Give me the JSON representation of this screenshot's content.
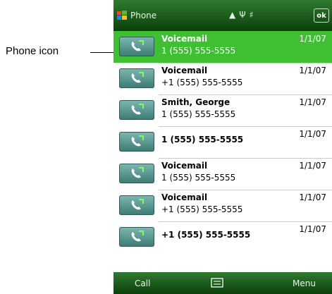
{
  "callout": {
    "label": "Phone icon"
  },
  "titlebar": {
    "title": "Phone",
    "status_icons": [
      "signal-icon",
      "antenna-icon",
      "volume-icon"
    ],
    "ok_label": "ok"
  },
  "call_log": [
    {
      "name": "Voicemail",
      "number": "1 (555) 555-5555",
      "date": "1/1/07",
      "selected": true
    },
    {
      "name": "Voicemail",
      "number": "+1 (555) 555-5555",
      "date": "1/1/07",
      "selected": false
    },
    {
      "name": "Smith, George",
      "number": "1 (555) 555-5555",
      "date": "1/1/07",
      "selected": false
    },
    {
      "name": "1 (555) 555-5555",
      "number": "",
      "date": "1/1/07",
      "selected": false
    },
    {
      "name": "Voicemail",
      "number": "1 (555) 555-5555",
      "date": "1/1/07",
      "selected": false
    },
    {
      "name": "Voicemail",
      "number": "+1 (555) 555-5555",
      "date": "1/1/07",
      "selected": false
    },
    {
      "name": "+1 (555) 555-5555",
      "number": "",
      "date": "1/1/07",
      "selected": false
    }
  ],
  "menubar": {
    "left_label": "Call",
    "center_icon": "keyboard-icon",
    "right_label": "Menu"
  },
  "colors": {
    "titlebar": "#1f5e1f",
    "selection": "#3fbf32",
    "phone_button": "#5c9994"
  }
}
